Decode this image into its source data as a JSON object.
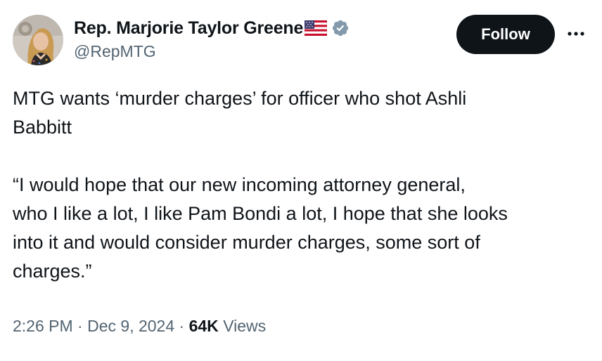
{
  "author": {
    "display_name": "Rep. Marjorie Taylor Greene",
    "handle": "@RepMTG",
    "avatar_icon": "profile-photo",
    "flag_icon": "us-flag-icon",
    "verified_icon": "verified-badge-icon",
    "verified_color": "#829aab"
  },
  "actions": {
    "follow_label": "Follow",
    "more_icon": "more-horizontal-icon"
  },
  "body": {
    "paragraph_1": "MTG wants ‘murder charges’ for officer who shot Ashli\nBabbitt",
    "paragraph_2": "“I would hope that our new incoming attorney general,\nwho I like a lot, I like Pam Bondi a lot, I hope that she looks\ninto it and would consider murder charges, some sort of\ncharges.”"
  },
  "meta": {
    "time": "2:26 PM",
    "separator": "·",
    "date": "Dec 9, 2024",
    "views_count": "64K",
    "views_label": "Views"
  },
  "colors": {
    "text_primary": "#0f1419",
    "text_secondary": "#536471",
    "follow_bg": "#0f1419",
    "follow_text": "#ffffff"
  }
}
